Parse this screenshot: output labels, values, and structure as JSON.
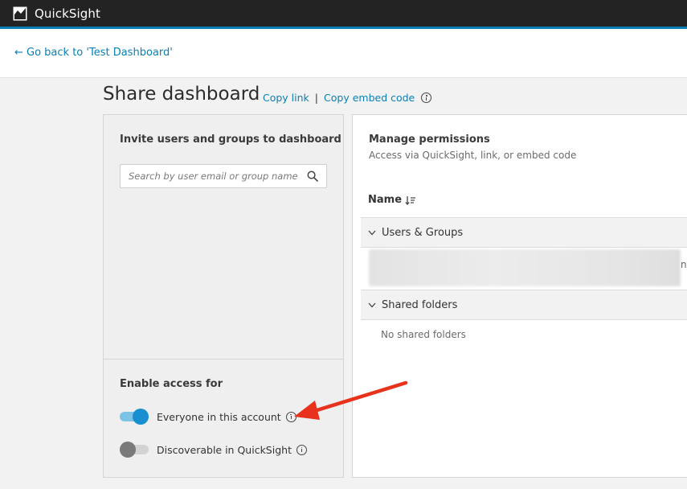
{
  "app": {
    "title": "QuickSight"
  },
  "nav": {
    "back_label": "← Go back to 'Test Dashboard'"
  },
  "header": {
    "title": "Share dashboard",
    "copy_link": "Copy link",
    "separator": "|",
    "copy_embed": "Copy embed code"
  },
  "invite": {
    "title": "Invite users and groups to dashboard",
    "search_placeholder": "Search by user email or group name"
  },
  "access": {
    "title": "Enable access for",
    "toggles": [
      {
        "label": "Everyone in this account",
        "state": "on"
      },
      {
        "label": "Discoverable in QuickSight",
        "state": "off"
      }
    ]
  },
  "permissions": {
    "title": "Manage permissions",
    "subtitle": "Access via QuickSight, link, or embed code",
    "name_column": "Name",
    "groups": [
      {
        "label": "Users & Groups",
        "expanded": true
      },
      {
        "label": "Shared folders",
        "expanded": true
      }
    ],
    "users_row_cut_text": "na",
    "shared_folders_empty": "No shared folders"
  },
  "colors": {
    "topbar": "#232323",
    "accent": "#0a7fb5",
    "toggle_on": "#1a8fd0",
    "annotation_arrow": "#e8321c"
  }
}
